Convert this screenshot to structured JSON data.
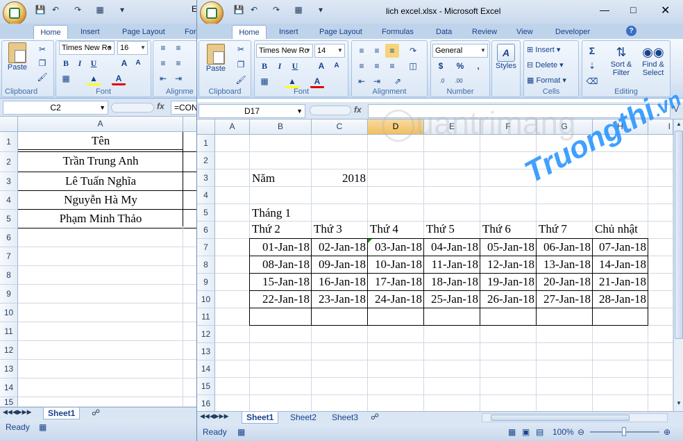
{
  "back_window": {
    "title_partial": "E",
    "tabs": [
      "Home",
      "Insert",
      "Page Layout",
      "For"
    ],
    "active_tab": "Home",
    "font_name": "Times New Ro",
    "font_size": "16",
    "groups": {
      "clipboard": "Clipboard",
      "font": "Font",
      "alignment": "Alignme"
    },
    "paste_label": "Paste",
    "name_box": "C2",
    "formula": "=CON",
    "columns": [
      "A"
    ],
    "rows": [
      "1",
      "2",
      "3",
      "4",
      "5",
      "6",
      "7",
      "8",
      "9",
      "10",
      "11",
      "12",
      "13",
      "14",
      "15"
    ],
    "cells": [
      "Tên",
      "Trần Trung Anh",
      "Lê Tuấn Nghĩa",
      "Nguyễn Hà My",
      "Phạm Minh Thảo"
    ],
    "sheet_tab": "Sheet1",
    "status": "Ready"
  },
  "front_window": {
    "title": "lich excel.xlsx - Microsoft Excel",
    "tabs": [
      "Home",
      "Insert",
      "Page Layout",
      "Formulas",
      "Data",
      "Review",
      "View",
      "Developer"
    ],
    "active_tab": "Home",
    "font_name": "Times New Ro",
    "font_size": "14",
    "number_format": "General",
    "paste_label": "Paste",
    "styles_label": "Styles",
    "cells_buttons": [
      "Insert",
      "Delete",
      "Format"
    ],
    "editing_buttons": [
      "Sort & Filter",
      "Find & Select"
    ],
    "groups": {
      "clipboard": "Clipboard",
      "font": "Font",
      "alignment": "Alignment",
      "number": "Number",
      "cells": "Cells",
      "editing": "Editing"
    },
    "name_box": "D17",
    "formula": "",
    "columns": [
      "A",
      "B",
      "C",
      "D",
      "E",
      "F",
      "G",
      "H",
      "I"
    ],
    "selected_column": "D",
    "rows": [
      "1",
      "2",
      "3",
      "4",
      "5",
      "6",
      "7",
      "8",
      "9",
      "10",
      "11",
      "12",
      "13",
      "14",
      "15",
      "16"
    ],
    "year_label": "Năm",
    "year_value": "2018",
    "month_label": "Tháng 1",
    "weekdays": [
      "Thứ 2",
      "Thứ 3",
      "Thứ 4",
      "Thứ 5",
      "Thứ 6",
      "Thứ 7",
      "Chủ nhật"
    ],
    "calendar": [
      [
        "01-Jan-18",
        "02-Jan-18",
        "03-Jan-18",
        "04-Jan-18",
        "05-Jan-18",
        "06-Jan-18",
        "07-Jan-18"
      ],
      [
        "08-Jan-18",
        "09-Jan-18",
        "10-Jan-18",
        "11-Jan-18",
        "12-Jan-18",
        "13-Jan-18",
        "14-Jan-18"
      ],
      [
        "15-Jan-18",
        "16-Jan-18",
        "17-Jan-18",
        "18-Jan-18",
        "19-Jan-18",
        "20-Jan-18",
        "21-Jan-18"
      ],
      [
        "22-Jan-18",
        "23-Jan-18",
        "24-Jan-18",
        "25-Jan-18",
        "26-Jan-18",
        "27-Jan-18",
        "28-Jan-18"
      ]
    ],
    "sheet_tabs": [
      "Sheet1",
      "Sheet2",
      "Sheet3"
    ],
    "active_sheet": "Sheet1",
    "status": "Ready",
    "zoom": "100%"
  },
  "watermark": {
    "brand": "Truongthi",
    "sub": "uantrimang",
    "suffix": "vn"
  },
  "colors": {
    "accent": "#15428b",
    "ribbon": "#dbe7f5",
    "selected_col": "#f1c15f"
  }
}
